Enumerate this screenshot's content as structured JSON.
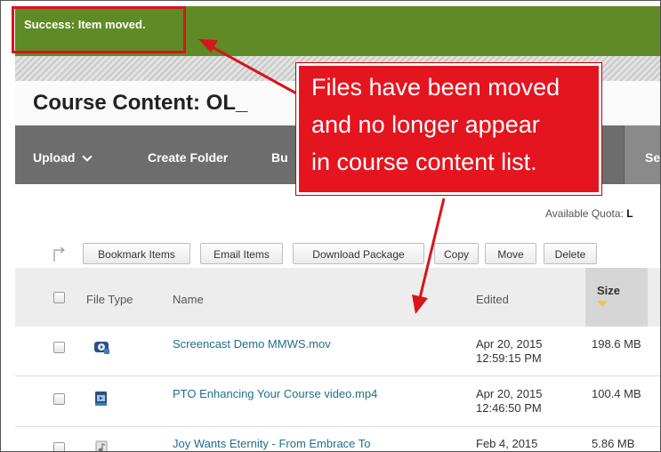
{
  "notification": {
    "text": "Success: Item moved."
  },
  "page": {
    "title": "Course Content: OL_"
  },
  "action_bar": {
    "upload": "Upload",
    "create_folder": "Create Folder",
    "partial_item": "Bu",
    "partial_right": "Se"
  },
  "quota": {
    "label": "Available Quota:",
    "value": "L"
  },
  "toolbar": {
    "bookmark": "Bookmark Items",
    "email": "Email Items",
    "download": "Download Package",
    "copy": "Copy",
    "move": "Move",
    "delete": "Delete"
  },
  "table": {
    "headers": {
      "file_type": "File Type",
      "name": "Name",
      "edited": "Edited",
      "size": "Size"
    },
    "rows": [
      {
        "name": "Screencast Demo MMWS.mov",
        "edited_date": "Apr 20, 2015",
        "edited_time": "12:59:15 PM",
        "size": "198.6 MB",
        "icon": "video-file-icon"
      },
      {
        "name": "PTO Enhancing Your Course video.mp4",
        "edited_date": "Apr 20, 2015",
        "edited_time": "12:46:50 PM",
        "size": "100.4 MB",
        "icon": "video-file-icon"
      },
      {
        "name": "Joy Wants Eternity - From Embrace To",
        "edited_date": "Feb 4, 2015",
        "edited_time": "",
        "size": "5.86 MB",
        "icon": "audio-file-icon"
      }
    ]
  },
  "callout": {
    "line1": "Files have been moved",
    "line2": "and no longer appear",
    "line3": "in course content list."
  },
  "colors": {
    "success": "#5e8b25",
    "callout": "#e4151f",
    "link": "#1f6e8c",
    "action_bar": "#6d6d6d"
  }
}
